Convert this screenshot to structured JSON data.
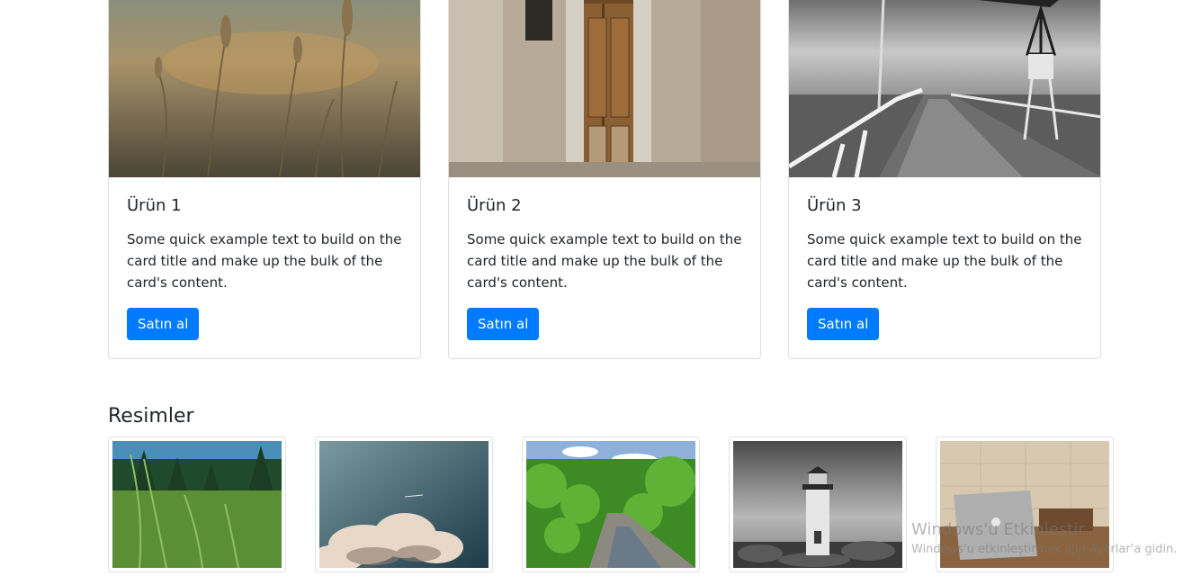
{
  "products": [
    {
      "title": "Ürün 1",
      "text": "Some quick example text to build on the card title and make up the bulk of the card's content.",
      "button": "Satın al",
      "image": "wheat-field-photo"
    },
    {
      "title": "Ürün 2",
      "text": "Some quick example text to build on the card title and make up the bulk of the card's content.",
      "button": "Satın al",
      "image": "wooden-door-photo"
    },
    {
      "title": "Ürün 3",
      "text": "Some quick example text to build on the card title and make up the bulk of the card's content.",
      "button": "Satın al",
      "image": "pier-photo"
    }
  ],
  "gallery": {
    "title": "Resimler",
    "images": [
      "grass-photo",
      "clouds-photo",
      "forest-river-photo",
      "lighthouse-photo",
      "laptop-desk-photo"
    ]
  },
  "watermark": {
    "line1": "Windows'u Etkinleştir",
    "line2": "Windows'u etkinleştirmek için Ayarlar'a gidin."
  },
  "colors": {
    "primary": "#007bff"
  }
}
